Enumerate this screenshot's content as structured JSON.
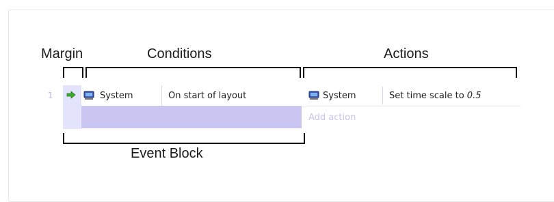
{
  "labels": {
    "margin": "Margin",
    "conditions": "Conditions",
    "actions": "Actions",
    "event_block": "Event Block"
  },
  "event": {
    "number": "1",
    "condition": {
      "object": "System",
      "text": "On start of layout"
    },
    "action": {
      "object": "System",
      "text_prefix": "Set time scale to ",
      "param": "0.5"
    },
    "add_action": "Add action"
  },
  "icons": {
    "run_arrow": "green-arrow-icon",
    "system": "system-monitor-icon"
  },
  "colors": {
    "margin_bg": "#e3e3fb",
    "block_bg": "#c9c6f1",
    "row_number": "#b9b9e6",
    "add_action": "#c8c4ee",
    "arrow": "#3daa2c"
  }
}
